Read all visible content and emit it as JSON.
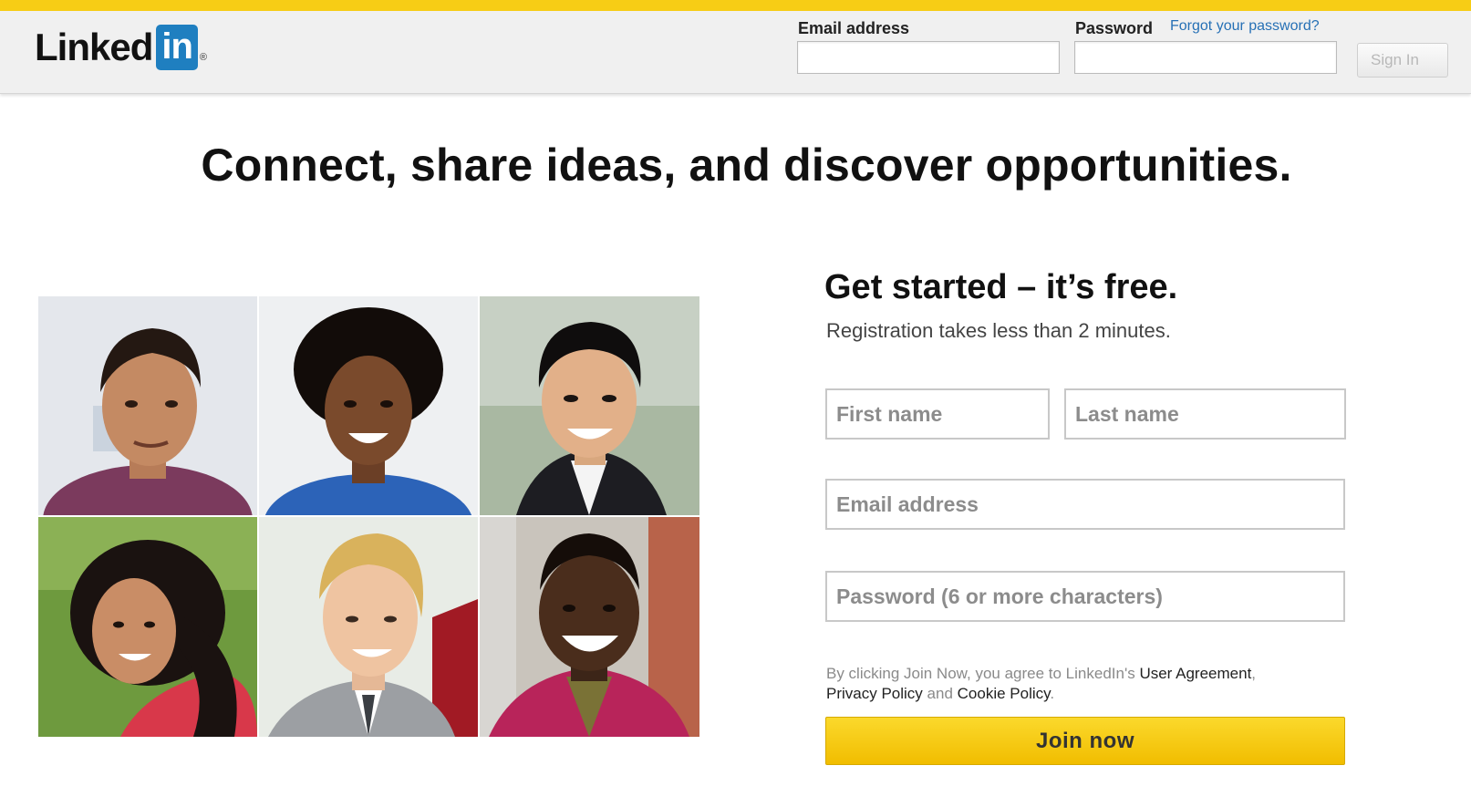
{
  "header": {
    "logo_text": "Linked",
    "logo_box": "in",
    "logo_reg": "®",
    "email_label": "Email address",
    "password_label": "Password",
    "forgot_link": "Forgot your password?",
    "signin_label": "Sign In"
  },
  "headline": "Connect, share ideas, and discover opportunities.",
  "signup": {
    "title": "Get started – it’s free.",
    "subtitle": "Registration takes less than 2 minutes.",
    "first_name_placeholder": "First name",
    "last_name_placeholder": "Last name",
    "email_placeholder": "Email address",
    "password_placeholder": "Password (6 or more characters)",
    "terms_prefix": "By clicking Join Now, you agree to LinkedIn's",
    "user_agreement": "User Agreement",
    "privacy_policy": "Privacy Policy",
    "and_word": "and",
    "cookie_policy": "Cookie Policy",
    "join_label": "Join now"
  },
  "colors": {
    "accent_yellow": "#f7cd15",
    "linkedin_blue": "#1f7fc0",
    "link_blue": "#2670b5"
  }
}
